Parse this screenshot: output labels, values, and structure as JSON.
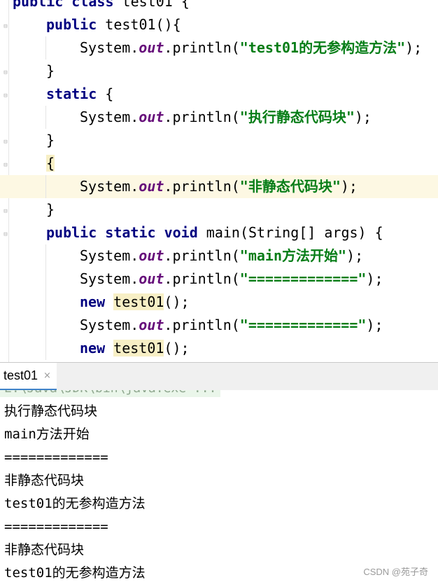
{
  "editor": {
    "lines": [
      {
        "segments": [
          {
            "t": "public class ",
            "c": "kw"
          },
          {
            "t": "test01 {",
            "c": ""
          }
        ]
      },
      {
        "segments": [
          {
            "t": "public ",
            "c": "kw"
          },
          {
            "t": "test01(){",
            "c": ""
          }
        ]
      },
      {
        "segments": [
          {
            "t": "System.",
            "c": ""
          },
          {
            "t": "out",
            "c": "field"
          },
          {
            "t": ".println(",
            "c": ""
          },
          {
            "t": "\"test01的无参构造方法\"",
            "c": "str"
          },
          {
            "t": ");",
            "c": ""
          }
        ]
      },
      {
        "segments": [
          {
            "t": "}",
            "c": ""
          }
        ]
      },
      {
        "segments": [
          {
            "t": "static ",
            "c": "kw"
          },
          {
            "t": "{",
            "c": ""
          }
        ]
      },
      {
        "segments": [
          {
            "t": "System.",
            "c": ""
          },
          {
            "t": "out",
            "c": "field"
          },
          {
            "t": ".println(",
            "c": ""
          },
          {
            "t": "\"执行静态代码块\"",
            "c": "str"
          },
          {
            "t": ");",
            "c": ""
          }
        ]
      },
      {
        "segments": [
          {
            "t": "}",
            "c": ""
          }
        ]
      },
      {
        "segments": [
          {
            "t": "{",
            "c": "brace-hl"
          }
        ]
      },
      {
        "segments": [
          {
            "t": "System.",
            "c": ""
          },
          {
            "t": "out",
            "c": "field"
          },
          {
            "t": ".println(",
            "c": ""
          },
          {
            "t": "\"非静态代码块\"",
            "c": "str"
          },
          {
            "t": ");",
            "c": ""
          }
        ]
      },
      {
        "segments": [
          {
            "t": "}",
            "c": ""
          }
        ]
      },
      {
        "segments": [
          {
            "t": "public static void ",
            "c": "kw"
          },
          {
            "t": "main(String[] args) {",
            "c": ""
          }
        ]
      },
      {
        "segments": [
          {
            "t": "System.",
            "c": ""
          },
          {
            "t": "out",
            "c": "field"
          },
          {
            "t": ".println(",
            "c": ""
          },
          {
            "t": "\"main方法开始\"",
            "c": "str"
          },
          {
            "t": ");",
            "c": ""
          }
        ]
      },
      {
        "segments": [
          {
            "t": "System.",
            "c": ""
          },
          {
            "t": "out",
            "c": "field"
          },
          {
            "t": ".println(",
            "c": ""
          },
          {
            "t": "\"=============\"",
            "c": "str"
          },
          {
            "t": ");",
            "c": ""
          }
        ]
      },
      {
        "segments": [
          {
            "t": "new ",
            "c": "kw"
          },
          {
            "t": "test01",
            "c": "hl"
          },
          {
            "t": "();",
            "c": ""
          }
        ]
      },
      {
        "segments": [
          {
            "t": "System.",
            "c": ""
          },
          {
            "t": "out",
            "c": "field"
          },
          {
            "t": ".println(",
            "c": ""
          },
          {
            "t": "\"=============\"",
            "c": "str"
          },
          {
            "t": ");",
            "c": ""
          }
        ]
      },
      {
        "segments": [
          {
            "t": "new ",
            "c": "kw"
          },
          {
            "t": "test01",
            "c": "hl"
          },
          {
            "t": "();",
            "c": ""
          }
        ]
      }
    ]
  },
  "run_panel": {
    "tab_label": "test01",
    "close_glyph": "×"
  },
  "console": {
    "header": "E:\\Java\\JDK\\bin\\java.exe ...",
    "lines": [
      "执行静态代码块",
      "main方法开始",
      "=============",
      "非静态代码块",
      "test01的无参构造方法",
      "=============",
      "非静态代码块",
      "test01的无参构造方法"
    ]
  },
  "watermark": "CSDN @苑子奇",
  "colors": {
    "keyword": "#000080",
    "string": "#067d17",
    "field": "#660e7a",
    "current_line": "#fdf8e3",
    "usage_highlight": "#f7efc5",
    "tab_underline": "#4083c9"
  }
}
